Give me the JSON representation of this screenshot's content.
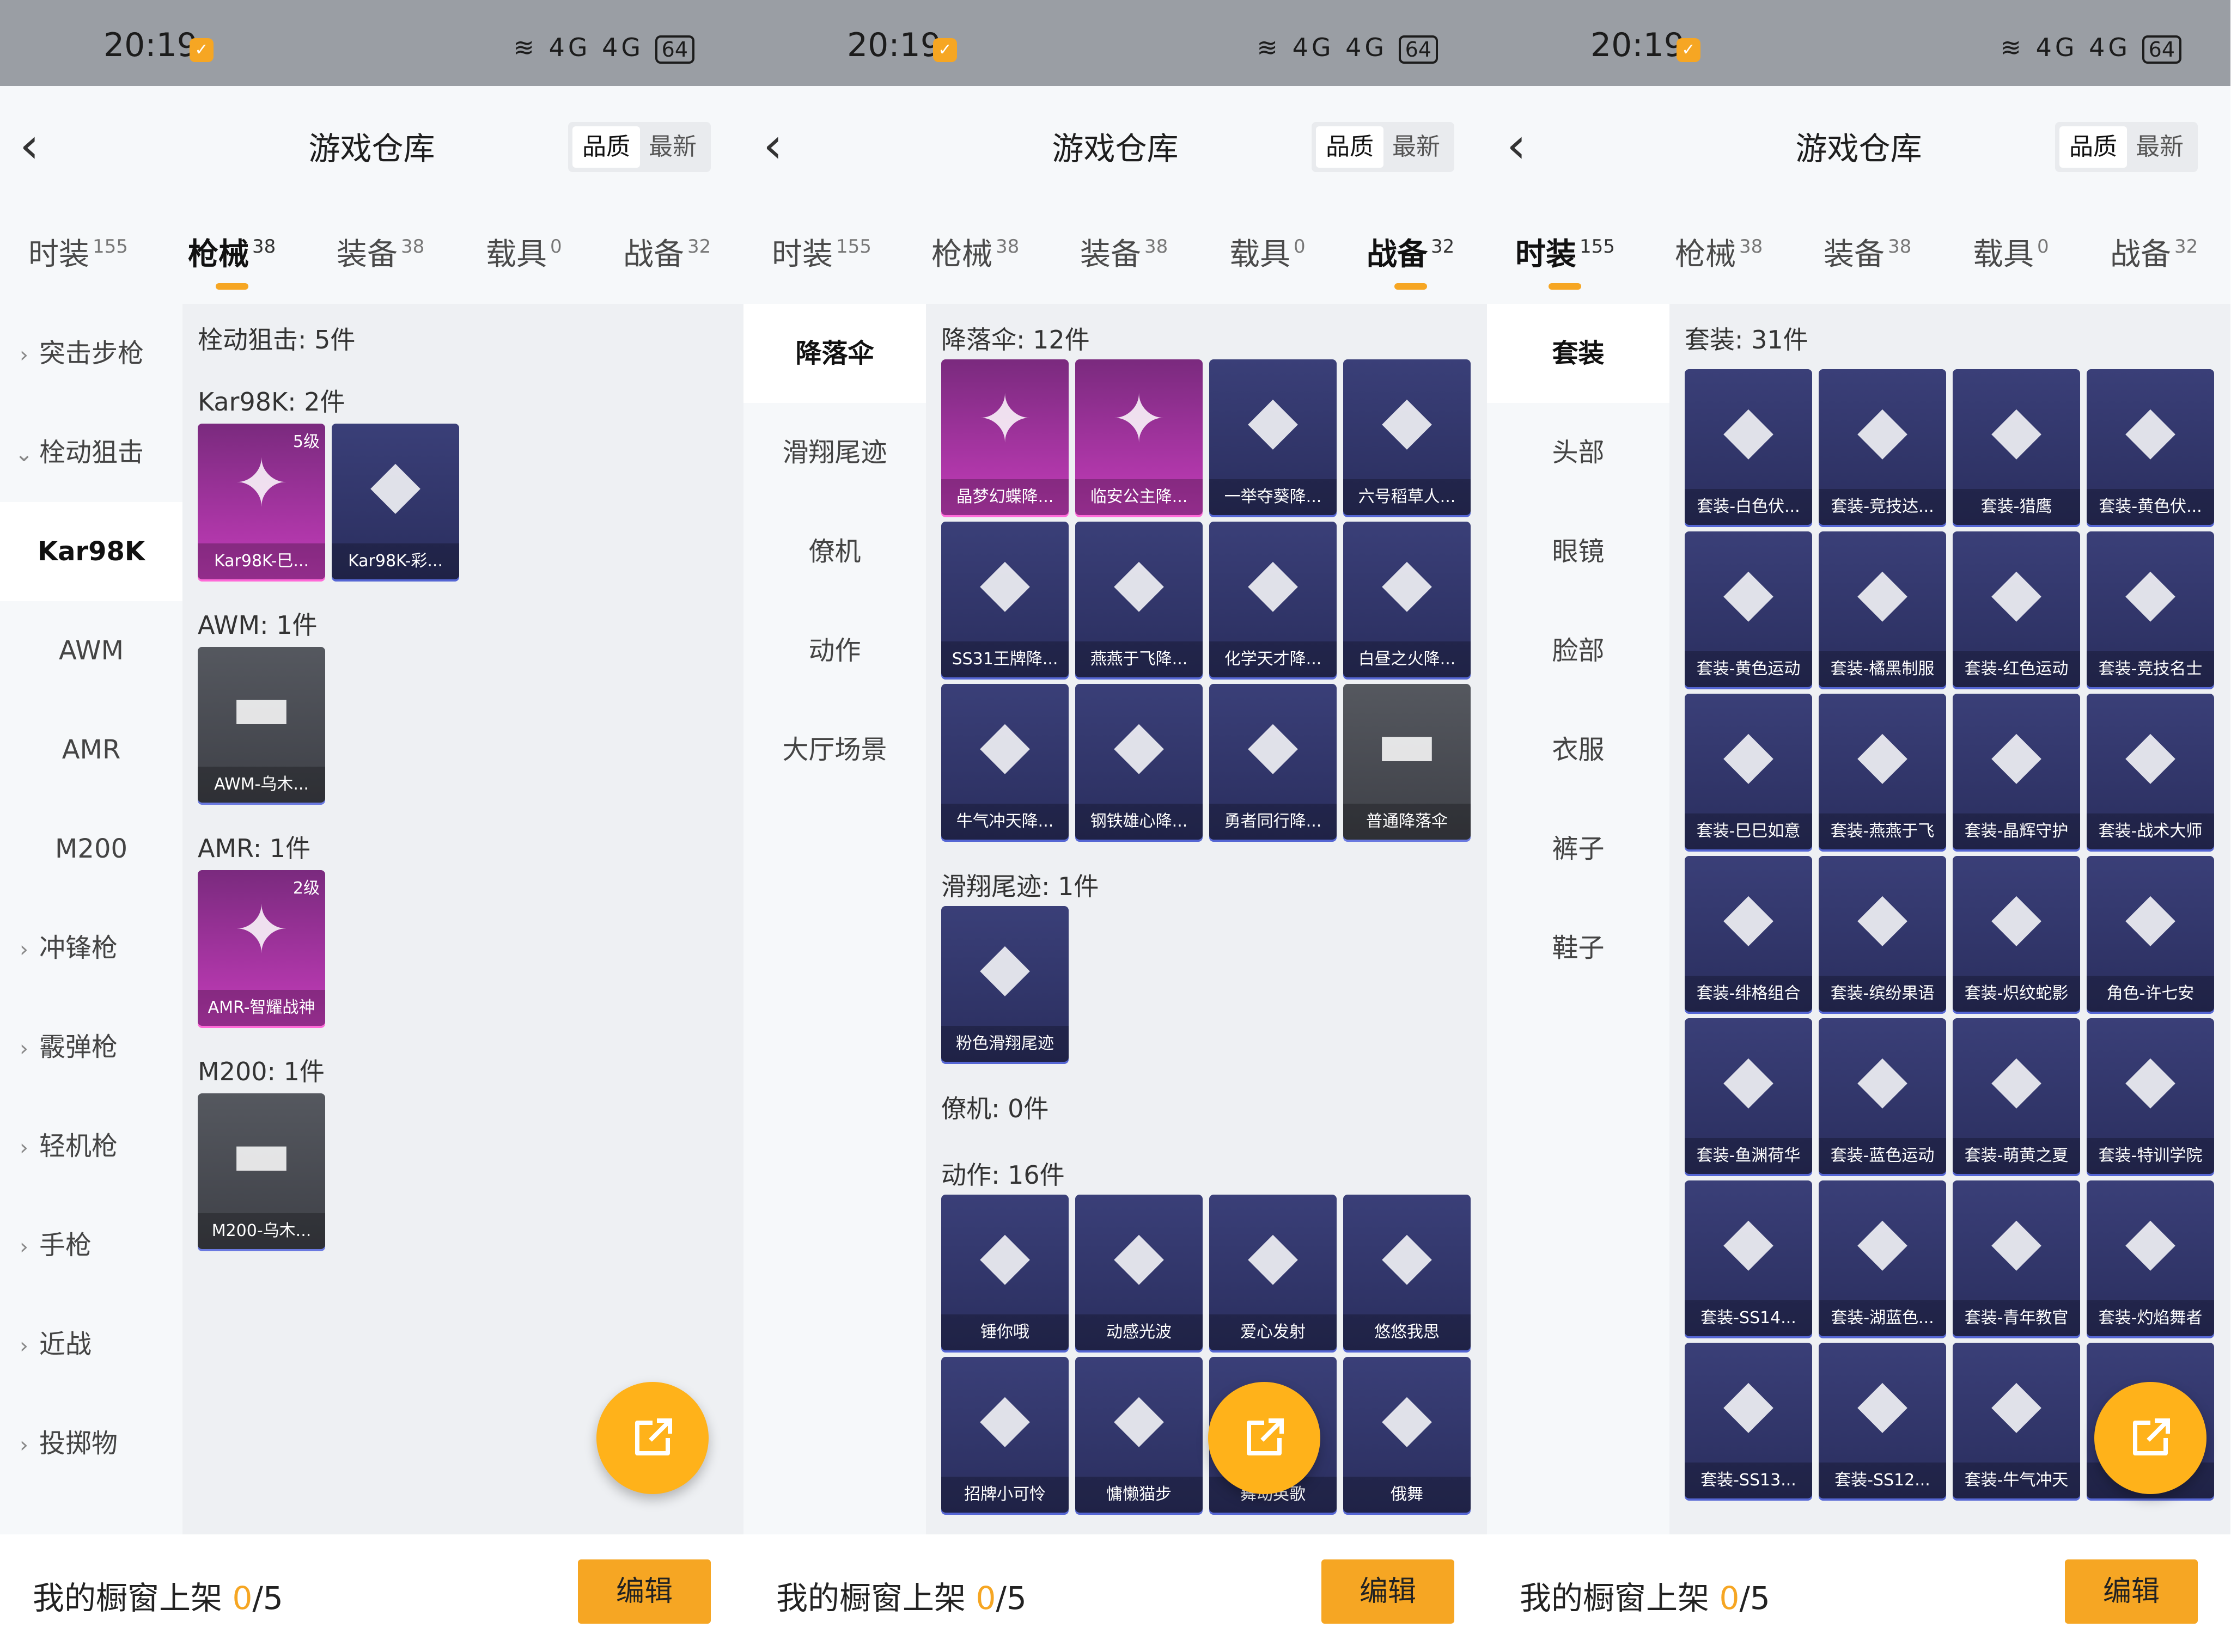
{
  "status": {
    "time": "20:19",
    "badge": "✓",
    "signal": "4G 4G",
    "battery": "64"
  },
  "nav": {
    "title": "游戏仓库",
    "sort_quality": "品质",
    "sort_latest": "最新",
    "back": "‹"
  },
  "tabs": [
    {
      "label": "时装",
      "count": "155"
    },
    {
      "label": "枪械",
      "count": "38"
    },
    {
      "label": "装备",
      "count": "38"
    },
    {
      "label": "载具",
      "count": "0"
    },
    {
      "label": "战备",
      "count": "32"
    }
  ],
  "bottom": {
    "prefix": "我的橱窗上架 ",
    "current": "0",
    "suffix": "/5",
    "edit": "编辑"
  },
  "accent": "#f6a623",
  "panel1": {
    "sidebar": [
      {
        "label": "突击步枪",
        "type": "group"
      },
      {
        "label": "栓动狙击",
        "type": "group-open"
      },
      {
        "label": "Kar98K",
        "type": "active"
      },
      {
        "label": "AWM",
        "type": "sub"
      },
      {
        "label": "AMR",
        "type": "sub"
      },
      {
        "label": "M200",
        "type": "sub"
      },
      {
        "label": "冲锋枪",
        "type": "group"
      },
      {
        "label": "霰弹枪",
        "type": "group"
      },
      {
        "label": "轻机枪",
        "type": "group"
      },
      {
        "label": "手枪",
        "type": "group"
      },
      {
        "label": "近战",
        "type": "group"
      },
      {
        "label": "投掷物",
        "type": "group"
      }
    ],
    "header": "栓动狙击: 5件",
    "sections": [
      {
        "label": "Kar98K: 2件",
        "items": [
          {
            "name": "Kar98K-巳...",
            "level": "5级",
            "style": "pink"
          },
          {
            "name": "Kar98K-彩...",
            "style": "blue"
          }
        ]
      },
      {
        "label": "AWM: 1件",
        "items": [
          {
            "name": "AWM-乌木...",
            "style": "grey"
          }
        ]
      },
      {
        "label": "AMR: 1件",
        "items": [
          {
            "name": "AMR-智耀战神",
            "level": "2级",
            "style": "pink"
          }
        ]
      },
      {
        "label": "M200: 1件",
        "items": [
          {
            "name": "M200-乌木...",
            "style": "grey"
          }
        ]
      }
    ]
  },
  "panel2": {
    "sidebar": [
      "降落伞",
      "滑翔尾迹",
      "僚机",
      "动作",
      "大厅场景"
    ],
    "sections": [
      {
        "label": "降落伞: 12件",
        "items": [
          {
            "name": "晶梦幻蝶降...",
            "style": "pink"
          },
          {
            "name": "临安公主降...",
            "style": "pink"
          },
          {
            "name": "一举夺葵降...",
            "style": "blue"
          },
          {
            "name": "六号稻草人...",
            "style": "blue"
          },
          {
            "name": "SS31王牌降...",
            "style": "blue"
          },
          {
            "name": "燕燕于飞降...",
            "style": "blue"
          },
          {
            "name": "化学天才降...",
            "style": "blue"
          },
          {
            "name": "白昼之火降...",
            "style": "blue"
          },
          {
            "name": "牛气冲天降...",
            "style": "blue"
          },
          {
            "name": "钢铁雄心降...",
            "style": "blue"
          },
          {
            "name": "勇者同行降...",
            "style": "blue"
          },
          {
            "name": "普通降落伞",
            "style": "grey"
          }
        ]
      },
      {
        "label": "滑翔尾迹: 1件",
        "items": [
          {
            "name": "粉色滑翔尾迹",
            "style": "blue"
          }
        ]
      },
      {
        "label": "僚机: 0件",
        "items": []
      },
      {
        "label": "动作: 16件",
        "items": [
          {
            "name": "锤你哦",
            "style": "blue"
          },
          {
            "name": "动感光波",
            "style": "blue"
          },
          {
            "name": "爱心发射",
            "style": "blue"
          },
          {
            "name": "悠悠我思",
            "style": "blue"
          },
          {
            "name": "招牌小可怜",
            "style": "blue"
          },
          {
            "name": "慵懒猫步",
            "style": "blue"
          },
          {
            "name": "舞动英歌",
            "style": "blue"
          },
          {
            "name": "俄舞",
            "style": "blue"
          }
        ]
      }
    ]
  },
  "panel3": {
    "sidebar": [
      "套装",
      "头部",
      "眼镜",
      "脸部",
      "衣服",
      "裤子",
      "鞋子"
    ],
    "header": "套装: 31件",
    "items": [
      "套装-白色伏...",
      "套装-竞技达...",
      "套装-猎鹰",
      "套装-黄色伏...",
      "套装-黄色运动",
      "套装-橘黑制服",
      "套装-红色运动",
      "套装-竞技名士",
      "套装-巳巳如意",
      "套装-燕燕于飞",
      "套装-晶辉守护",
      "套装-战术大师",
      "套装-绯格组合",
      "套装-缤纷果语",
      "套装-炽纹蛇影",
      "角色-许七安",
      "套装-鱼渊荷华",
      "套装-蓝色运动",
      "套装-萌黄之夏",
      "套装-特训学院",
      "套装-SS14...",
      "套装-湖蓝色...",
      "套装-青年教官",
      "套装-灼焰舞者",
      "套装-SS13...",
      "套装-SS12...",
      "套装-牛气冲天",
      "套装-..."
    ]
  }
}
